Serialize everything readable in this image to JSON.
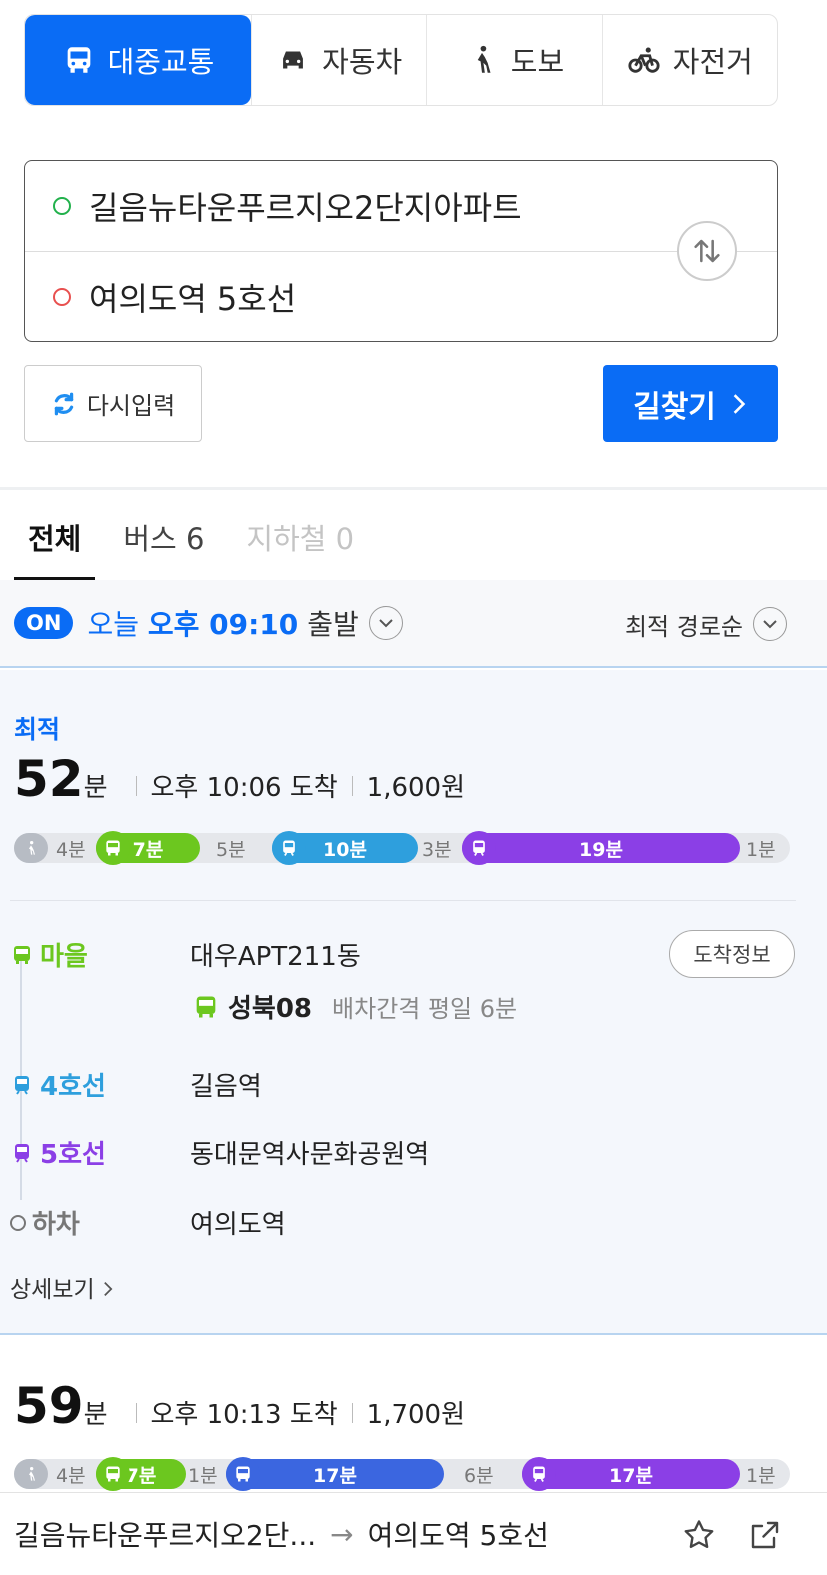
{
  "modes": [
    {
      "label": "대중교통",
      "icon": "bus-icon",
      "active": true
    },
    {
      "label": "자동차",
      "icon": "car-icon"
    },
    {
      "label": "도보",
      "icon": "walk-icon"
    },
    {
      "label": "자전거",
      "icon": "bicycle-icon"
    }
  ],
  "route": {
    "start": "길음뉴타운푸르지오2단지아파트",
    "end": "여의도역 5호선",
    "reset_label": "다시입력",
    "search_label": "길찾기"
  },
  "filter_tabs": [
    {
      "label": "전체",
      "active": true
    },
    {
      "label": "버스 6"
    },
    {
      "label": "지하철 0",
      "disabled": true
    }
  ],
  "departure": {
    "on_label": "ON",
    "day": "오늘",
    "time": "오후 09:10",
    "suffix": "출발",
    "sort_label": "최적 경로순"
  },
  "colors": {
    "accent": "#0a6cf5",
    "village_bus": "#6cc71f",
    "line4": "#2e9fdd",
    "line5": "#8b3fe6",
    "bus_blue": "#3b66e0"
  },
  "results": [
    {
      "badge": "최적",
      "minutes": "52",
      "minutes_unit": "분",
      "arrival": "오후 10:06 도착",
      "fare": "1,600원",
      "segments": {
        "walk1": "4분",
        "bus": "7분",
        "gap1": "5분",
        "subway4": "10분",
        "gap2": "3분",
        "subway5": "19분",
        "walk2": "1분"
      },
      "steps": [
        {
          "type": "마을",
          "stop": "대우APT211동"
        },
        {
          "type": "4호선",
          "stop": "길음역"
        },
        {
          "type": "5호선",
          "stop": "동대문역사문화공원역"
        },
        {
          "type": "하차",
          "stop": "여의도역"
        }
      ],
      "arrival_info_label": "도착정보",
      "bus_line": "성북08",
      "bus_interval": "배차간격 평일 6분",
      "detail_label": "상세보기"
    },
    {
      "minutes": "59",
      "minutes_unit": "분",
      "arrival": "오후 10:13 도착",
      "fare": "1,700원",
      "segments": {
        "walk1": "4분",
        "bus": "7분",
        "gap1": "1분",
        "bus2": "17분",
        "gap2": "6분",
        "subway5": "17분",
        "walk2": "1분"
      }
    }
  ],
  "bottom": {
    "from": "길음뉴타운푸르지오2단...",
    "to": "여의도역 5호선",
    "arrow": "→"
  }
}
